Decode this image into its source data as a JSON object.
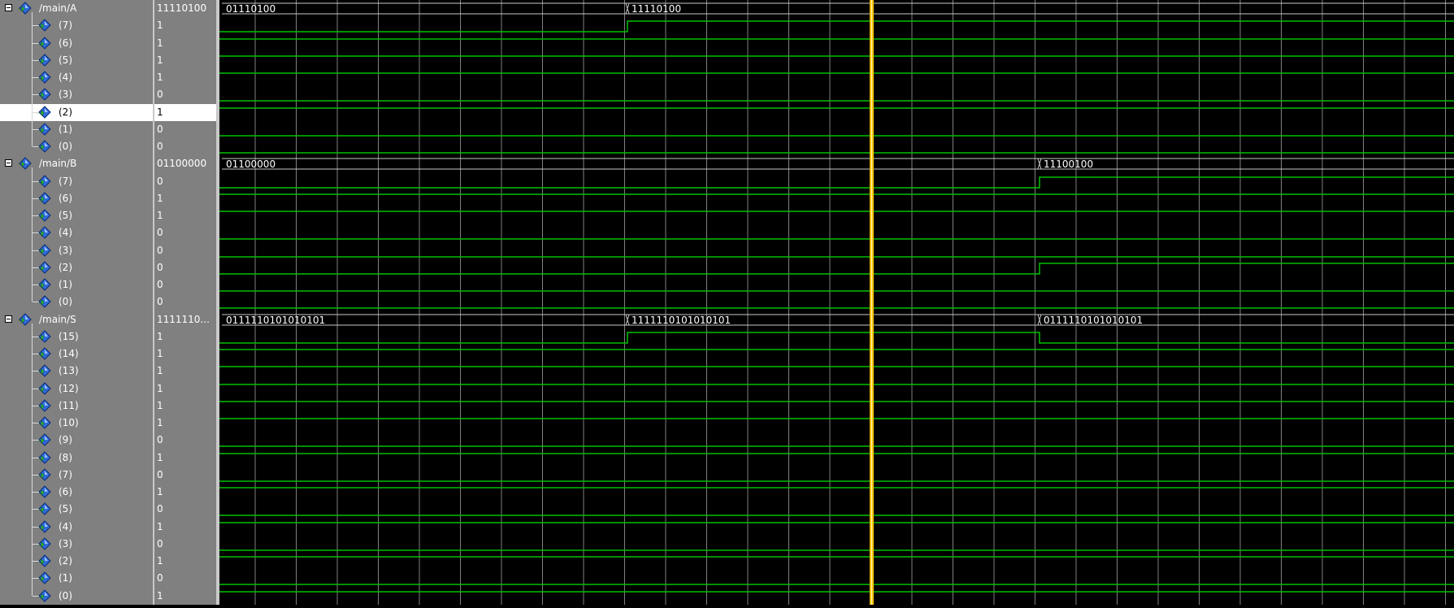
{
  "signals": [
    {
      "name": "/main/A",
      "value": "11110100",
      "group": true
    },
    {
      "name": "(7)",
      "value": "1"
    },
    {
      "name": "(6)",
      "value": "1"
    },
    {
      "name": "(5)",
      "value": "1"
    },
    {
      "name": "(4)",
      "value": "1"
    },
    {
      "name": "(3)",
      "value": "0"
    },
    {
      "name": "(2)",
      "value": "1",
      "selected": true
    },
    {
      "name": "(1)",
      "value": "0"
    },
    {
      "name": "(0)",
      "value": "0"
    },
    {
      "name": "/main/B",
      "value": "01100000",
      "group": true
    },
    {
      "name": "(7)",
      "value": "0"
    },
    {
      "name": "(6)",
      "value": "1"
    },
    {
      "name": "(5)",
      "value": "1"
    },
    {
      "name": "(4)",
      "value": "0"
    },
    {
      "name": "(3)",
      "value": "0"
    },
    {
      "name": "(2)",
      "value": "0"
    },
    {
      "name": "(1)",
      "value": "0"
    },
    {
      "name": "(0)",
      "value": "0"
    },
    {
      "name": "/main/S",
      "value": "1111110...",
      "group": true
    },
    {
      "name": "(15)",
      "value": "1"
    },
    {
      "name": "(14)",
      "value": "1"
    },
    {
      "name": "(13)",
      "value": "1"
    },
    {
      "name": "(12)",
      "value": "1"
    },
    {
      "name": "(11)",
      "value": "1"
    },
    {
      "name": "(10)",
      "value": "1"
    },
    {
      "name": "(9)",
      "value": "0"
    },
    {
      "name": "(8)",
      "value": "1"
    },
    {
      "name": "(7)",
      "value": "0"
    },
    {
      "name": "(6)",
      "value": "1"
    },
    {
      "name": "(5)",
      "value": "0"
    },
    {
      "name": "(4)",
      "value": "1"
    },
    {
      "name": "(3)",
      "value": "0"
    },
    {
      "name": "(2)",
      "value": "1"
    },
    {
      "name": "(1)",
      "value": "0"
    },
    {
      "name": "(0)",
      "value": "1"
    }
  ],
  "waves": {
    "A": {
      "segments": [
        {
          "label": "01110100",
          "t0": 0,
          "t1": 502
        },
        {
          "label": "11110100",
          "t0": 502,
          "t1": 1519
        }
      ],
      "bits": [
        [
          0,
          1
        ],
        [
          1,
          1
        ],
        [
          1,
          1
        ],
        [
          1,
          1
        ],
        [
          0,
          0
        ],
        [
          1,
          1
        ],
        [
          0,
          0
        ],
        [
          0,
          0
        ]
      ]
    },
    "B": {
      "segments": [
        {
          "label": "01100000",
          "t0": 0,
          "t1": 1009
        },
        {
          "label": "11100100",
          "t0": 1009,
          "t1": 1519
        }
      ],
      "bits": [
        [
          0,
          1
        ],
        [
          1,
          1
        ],
        [
          1,
          1
        ],
        [
          0,
          0
        ],
        [
          0,
          0
        ],
        [
          0,
          1
        ],
        [
          0,
          0
        ],
        [
          0,
          0
        ]
      ]
    },
    "S": {
      "segments": [
        {
          "label": "0111110101010101",
          "t0": 0,
          "t1": 502
        },
        {
          "label": "1111110101010101",
          "t0": 502,
          "t1": 1009
        },
        {
          "label": "0111110101010101",
          "t0": 1009,
          "t1": 1519
        }
      ],
      "bits": [
        [
          0,
          1,
          0
        ],
        [
          1,
          1,
          1
        ],
        [
          1,
          1,
          1
        ],
        [
          1,
          1,
          1
        ],
        [
          1,
          1,
          1
        ],
        [
          1,
          1,
          1
        ],
        [
          0,
          0,
          0
        ],
        [
          1,
          1,
          1
        ],
        [
          0,
          0,
          0
        ],
        [
          1,
          1,
          1
        ],
        [
          0,
          0,
          0
        ],
        [
          1,
          1,
          1
        ],
        [
          0,
          0,
          0
        ],
        [
          1,
          1,
          1
        ],
        [
          0,
          0,
          0
        ],
        [
          1,
          1,
          1
        ]
      ]
    }
  },
  "colors": {
    "wave": "#00c000",
    "grid": "#a0a0a0",
    "cursor": "#ffc000",
    "bus_text": "#ffffff"
  },
  "icon": "signal-diamond-icon"
}
